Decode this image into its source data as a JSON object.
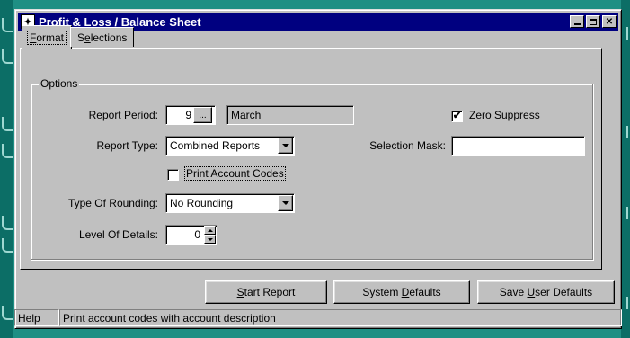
{
  "window": {
    "title": "Profit & Loss / Balance Sheet",
    "title_icon": "running-man-icon"
  },
  "tabs": [
    {
      "label": "Format",
      "hotkey": "F",
      "rest": "ormat",
      "active": true
    },
    {
      "label": "Selections",
      "pre": "S",
      "hotkey": "e",
      "rest": "lections",
      "active": false
    }
  ],
  "options": {
    "group_label": "Options",
    "report_period": {
      "label": "Report Period:",
      "value": "9",
      "browse_label": "...",
      "month": "March"
    },
    "zero_suppress": {
      "label": "Zero Suppress",
      "checked": true,
      "mark": "✔"
    },
    "report_type": {
      "label": "Report Type:",
      "value": "Combined Reports"
    },
    "selection_mask": {
      "label": "Selection Mask:",
      "value": ""
    },
    "print_account_codes": {
      "label": "Print Account Codes",
      "checked": false
    },
    "type_of_rounding": {
      "label": "Type Of Rounding:",
      "value": "No Rounding"
    },
    "level_of_details": {
      "label": "Level Of Details:",
      "value": "0"
    }
  },
  "buttons": {
    "start_report": {
      "pre": "",
      "hotkey": "S",
      "rest": "tart Report"
    },
    "system_defaults": {
      "pre": "System ",
      "hotkey": "D",
      "rest": "efaults"
    },
    "save_user_defaults": {
      "pre": "Save ",
      "hotkey": "U",
      "rest": "ser Defaults"
    }
  },
  "status": {
    "label": "Help",
    "message": "Print account codes with account description"
  },
  "colors": {
    "titlebar": "#000080",
    "face": "#c0c0c0",
    "desktop": "#1f8f84"
  }
}
